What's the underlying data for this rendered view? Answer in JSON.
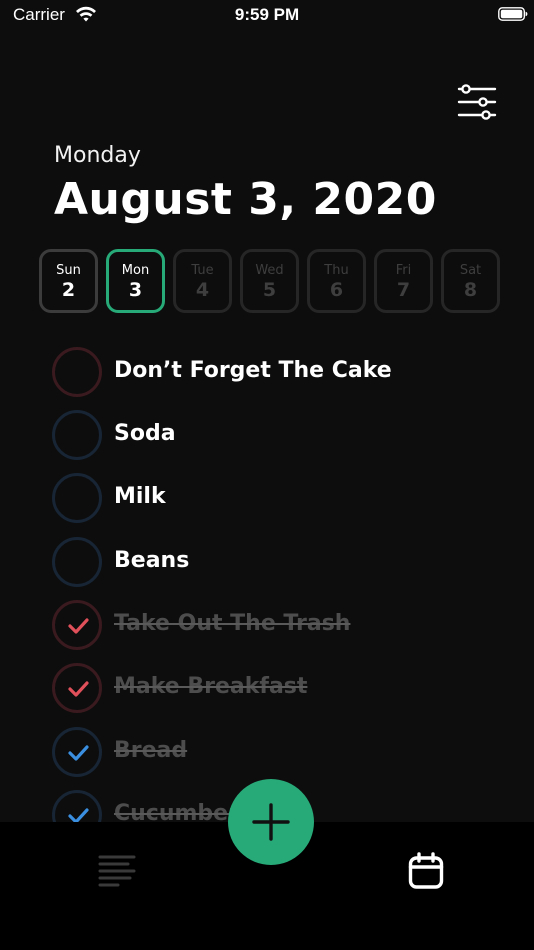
{
  "status_bar": {
    "carrier": "Carrier",
    "time": "9:59 PM"
  },
  "header": {
    "weekday": "Monday",
    "date": "August 3, 2020"
  },
  "week": [
    {
      "name": "Sun",
      "num": "2",
      "state": "past"
    },
    {
      "name": "Mon",
      "num": "3",
      "state": "active"
    },
    {
      "name": "Tue",
      "num": "4",
      "state": "future"
    },
    {
      "name": "Wed",
      "num": "5",
      "state": "future"
    },
    {
      "name": "Thu",
      "num": "6",
      "state": "future"
    },
    {
      "name": "Fri",
      "num": "7",
      "state": "future"
    },
    {
      "name": "Sat",
      "num": "8",
      "state": "future"
    }
  ],
  "tasks": [
    {
      "label": "Don’t Forget The Cake",
      "done": false,
      "color": "red"
    },
    {
      "label": "Soda",
      "done": false,
      "color": "blue"
    },
    {
      "label": "Milk",
      "done": false,
      "color": "blue"
    },
    {
      "label": "Beans",
      "done": false,
      "color": "blue"
    },
    {
      "label": "Take Out The Trash",
      "done": true,
      "color": "red"
    },
    {
      "label": "Make Breakfast",
      "done": true,
      "color": "red"
    },
    {
      "label": "Bread",
      "done": true,
      "color": "blue"
    },
    {
      "label": "Cucumber",
      "done": true,
      "color": "blue"
    }
  ],
  "colors": {
    "accent": "#27a978",
    "red_ring": "#3a1a1e",
    "red_check": "#e0505a",
    "blue_ring": "#172535",
    "blue_check": "#3b8fe0",
    "background": "#0d0d0d"
  },
  "icons": {
    "filter": "sliders-icon",
    "tab_list": "list-icon",
    "tab_calendar": "calendar-icon",
    "fab": "plus-icon"
  }
}
